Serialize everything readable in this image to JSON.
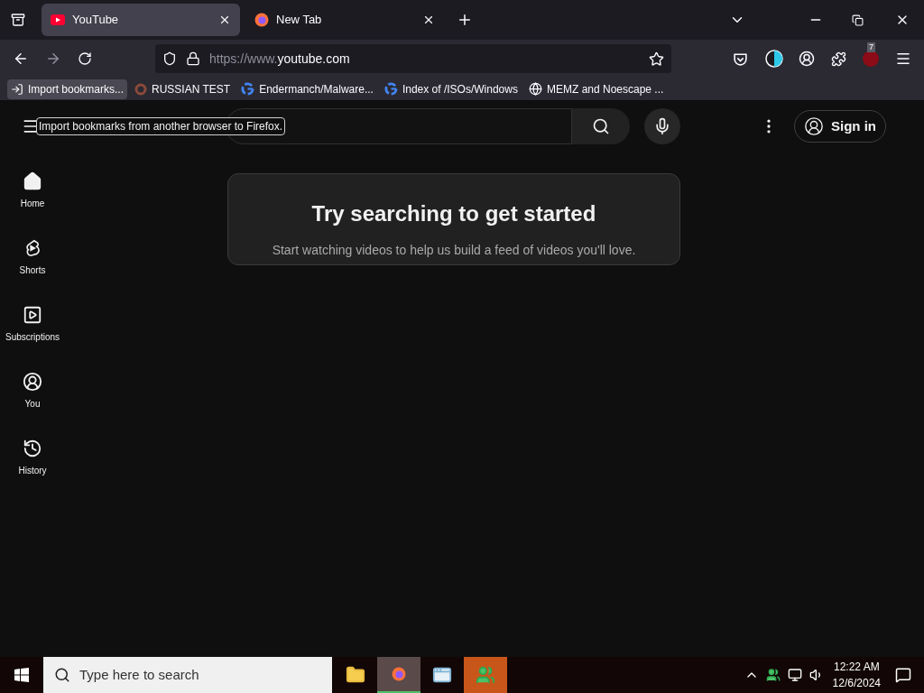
{
  "browser": {
    "tabs": [
      {
        "title": "YouTube",
        "kind": "youtube",
        "selected": true
      },
      {
        "title": "New Tab",
        "kind": "firefox",
        "selected": false
      }
    ],
    "url": {
      "scheme": "https://www.",
      "host": "youtube.com"
    },
    "extension_badge": "7",
    "bookmarks": [
      {
        "label": "Import bookmarks...",
        "kind": "import",
        "selected": true
      },
      {
        "label": "RUSSIAN TEST",
        "kind": "ring",
        "selected": false
      },
      {
        "label": "Endermanch/Malware...",
        "kind": "google",
        "selected": false
      },
      {
        "label": "Index of /ISOs/Windows",
        "kind": "google",
        "selected": false
      },
      {
        "label": "MEMZ and Noescape ...",
        "kind": "globe",
        "selected": false
      }
    ],
    "tooltip": "Import bookmarks from another browser to Firefox."
  },
  "youtube": {
    "sign_in": "Sign in",
    "sidebar": [
      {
        "label": "Home",
        "kind": "home",
        "selected": true
      },
      {
        "label": "Shorts",
        "kind": "shorts",
        "selected": false
      },
      {
        "label": "Subscriptions",
        "kind": "subscriptions",
        "selected": false
      },
      {
        "label": "You",
        "kind": "you",
        "selected": false
      },
      {
        "label": "History",
        "kind": "history",
        "selected": false
      }
    ],
    "card": {
      "title": "Try searching to get started",
      "text": "Start watching videos to help us build a feed of videos you'll love."
    }
  },
  "taskbar": {
    "search_placeholder": "Type here to search",
    "apps": [
      {
        "kind": "folder",
        "selected": false
      },
      {
        "kind": "firefox",
        "selected": true
      },
      {
        "kind": "window",
        "selected": false
      },
      {
        "kind": "people",
        "selected": false
      }
    ],
    "time": "12:22 AM",
    "date": "12/6/2024"
  }
}
